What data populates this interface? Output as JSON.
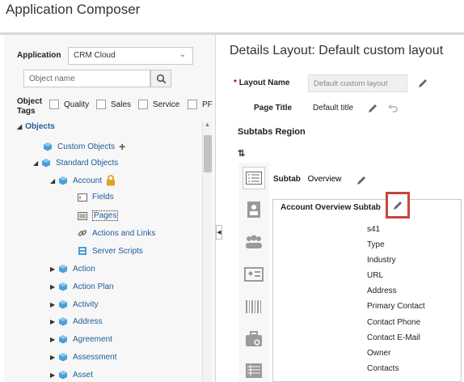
{
  "app": {
    "title": "Application Composer"
  },
  "left": {
    "application_label": "Application",
    "application_value": "CRM Cloud",
    "search_placeholder": "Object name",
    "object_tags_label_1": "Object",
    "object_tags_label_2": "Tags",
    "tags": [
      "Quality",
      "Sales",
      "Service",
      "PF"
    ],
    "tree_header": "Objects",
    "tree": [
      {
        "label": "Custom Objects"
      },
      {
        "label": "Standard Objects"
      },
      {
        "label": "Account"
      },
      {
        "label": "Fields"
      },
      {
        "label": "Pages"
      },
      {
        "label": "Actions and Links"
      },
      {
        "label": "Server Scripts"
      },
      {
        "label": "Action"
      },
      {
        "label": "Action Plan"
      },
      {
        "label": "Activity"
      },
      {
        "label": "Address"
      },
      {
        "label": "Agreement"
      },
      {
        "label": "Assessment"
      },
      {
        "label": "Asset"
      }
    ]
  },
  "right": {
    "title": "Details Layout: Default custom layout",
    "layout_name_label": "Layout Name",
    "layout_name_required": "*",
    "layout_name_value": "Default custom layout",
    "page_title_label": "Page Title",
    "page_title_value": "Default title",
    "subtabs_region": "Subtabs Region",
    "subtab_label": "Subtab",
    "subtab_value": "Overview",
    "section_title": "Account Overview Subtab",
    "fields": [
      "s41",
      "Type",
      "Industry",
      "URL",
      "Address",
      "Primary Contact",
      "Contact Phone",
      "Contact E-Mail",
      "Owner",
      "Contacts"
    ]
  },
  "colors": {
    "link": "#1f5b9a",
    "highlight": "#c9453a",
    "lock": "#e0a021"
  }
}
